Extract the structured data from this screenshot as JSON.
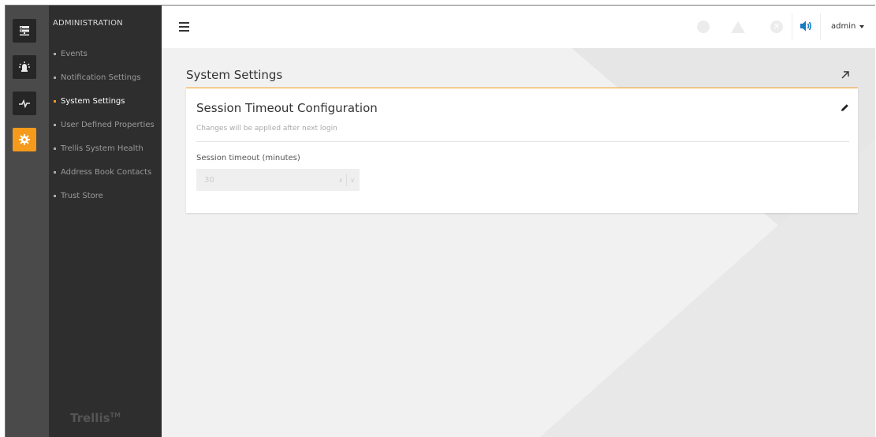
{
  "rail": {
    "items": [
      {
        "name": "server-icon",
        "active": false
      },
      {
        "name": "alarm-icon",
        "active": false
      },
      {
        "name": "pulse-icon",
        "active": false
      },
      {
        "name": "gear-icon",
        "active": true
      }
    ]
  },
  "nav": {
    "title": "ADMINISTRATION",
    "items": [
      {
        "label": "Events"
      },
      {
        "label": "Notification Settings"
      },
      {
        "label": "System Settings",
        "active": true
      },
      {
        "label": "User Defined Properties"
      },
      {
        "label": "Trellis System Health"
      },
      {
        "label": "Address Book Contacts"
      },
      {
        "label": "Trust Store"
      }
    ],
    "brand": "Trellis",
    "brand_mark": "TM"
  },
  "topbar": {
    "status_x_glyph": "✕",
    "user": "admin"
  },
  "page": {
    "title": "System Settings"
  },
  "card": {
    "title": "Session Timeout Configuration",
    "subtitle": "Changes will be applied after next login",
    "field_label": "Session timeout (minutes)",
    "field_value": "30",
    "spin_up": "∧",
    "spin_down": "∨"
  },
  "colors": {
    "accent": "#f59a1b",
    "rail_bg": "#4a4a4a",
    "nav_bg": "#2e2e2e",
    "speaker": "#1a7cc2"
  }
}
